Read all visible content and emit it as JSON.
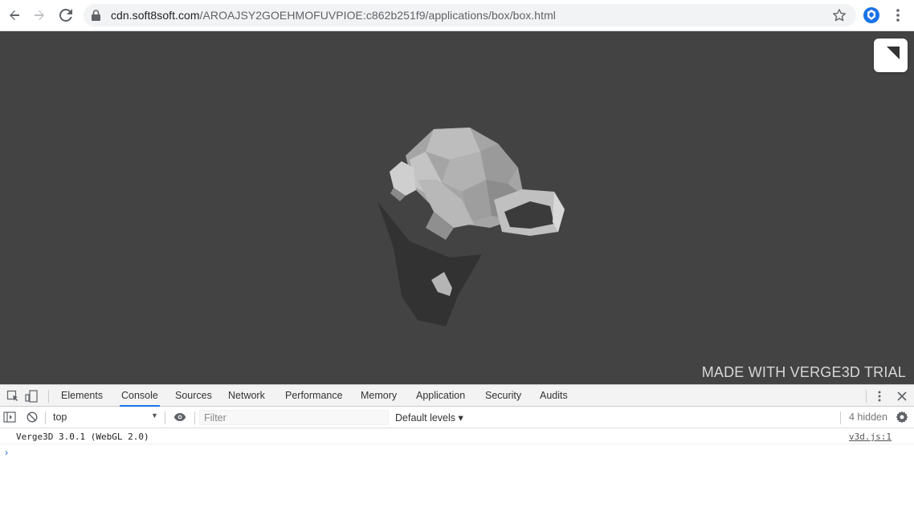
{
  "browser": {
    "url_host": "cdn.soft8soft.com",
    "url_path": "/AROAJSY2GOEHMOFUVPIOE:c862b251f9/applications/box/box.html"
  },
  "viewport": {
    "background": "#434343",
    "watermark": "MADE WITH VERGE3D TRIAL"
  },
  "devtools": {
    "tabs": [
      "Elements",
      "Console",
      "Sources",
      "Network",
      "Performance",
      "Memory",
      "Application",
      "Security",
      "Audits"
    ],
    "active_tab": "Console",
    "context": "top",
    "filter_placeholder": "Filter",
    "levels": "Default levels ▾",
    "hidden_count": "4 hidden",
    "console": {
      "message": "Verge3D 3.0.1 (WebGL 2.0)",
      "source": "v3d.js:1",
      "prompt": "›"
    },
    "accent": "#1a73e8"
  }
}
